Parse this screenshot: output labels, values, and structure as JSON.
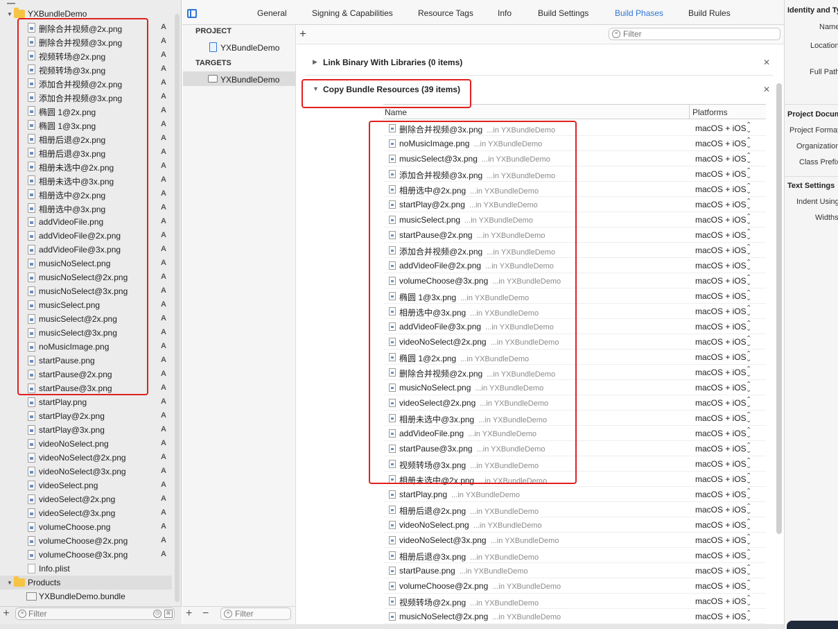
{
  "navigator": {
    "group_name": "YXBundleDemo",
    "files": [
      {
        "name": "删除合并视频@2x.png",
        "badge": "A"
      },
      {
        "name": "删除合并视频@3x.png",
        "badge": "A"
      },
      {
        "name": "视频转场@2x.png",
        "badge": "A"
      },
      {
        "name": "视频转场@3x.png",
        "badge": "A"
      },
      {
        "name": "添加合并视频@2x.png",
        "badge": "A"
      },
      {
        "name": "添加合并视频@3x.png",
        "badge": "A"
      },
      {
        "name": "椭圆 1@2x.png",
        "badge": "A"
      },
      {
        "name": "椭圆 1@3x.png",
        "badge": "A"
      },
      {
        "name": "相册后退@2x.png",
        "badge": "A"
      },
      {
        "name": "相册后退@3x.png",
        "badge": "A"
      },
      {
        "name": "相册未选中@2x.png",
        "badge": "A"
      },
      {
        "name": "相册未选中@3x.png",
        "badge": "A"
      },
      {
        "name": "相册选中@2x.png",
        "badge": "A"
      },
      {
        "name": "相册选中@3x.png",
        "badge": "A"
      },
      {
        "name": "addVideoFile.png",
        "badge": "A"
      },
      {
        "name": "addVideoFile@2x.png",
        "badge": "A"
      },
      {
        "name": "addVideoFile@3x.png",
        "badge": "A"
      },
      {
        "name": "musicNoSelect.png",
        "badge": "A"
      },
      {
        "name": "musicNoSelect@2x.png",
        "badge": "A"
      },
      {
        "name": "musicNoSelect@3x.png",
        "badge": "A"
      },
      {
        "name": "musicSelect.png",
        "badge": "A"
      },
      {
        "name": "musicSelect@2x.png",
        "badge": "A"
      },
      {
        "name": "musicSelect@3x.png",
        "badge": "A"
      },
      {
        "name": "noMusicImage.png",
        "badge": "A"
      },
      {
        "name": "startPause.png",
        "badge": "A"
      },
      {
        "name": "startPause@2x.png",
        "badge": "A"
      },
      {
        "name": "startPause@3x.png",
        "badge": "A"
      },
      {
        "name": "startPlay.png",
        "badge": "A"
      },
      {
        "name": "startPlay@2x.png",
        "badge": "A"
      },
      {
        "name": "startPlay@3x.png",
        "badge": "A"
      },
      {
        "name": "videoNoSelect.png",
        "badge": "A"
      },
      {
        "name": "videoNoSelect@2x.png",
        "badge": "A"
      },
      {
        "name": "videoNoSelect@3x.png",
        "badge": "A"
      },
      {
        "name": "videoSelect.png",
        "badge": "A"
      },
      {
        "name": "videoSelect@2x.png",
        "badge": "A"
      },
      {
        "name": "videoSelect@3x.png",
        "badge": "A"
      },
      {
        "name": "volumeChoose.png",
        "badge": "A"
      },
      {
        "name": "volumeChoose@2x.png",
        "badge": "A"
      },
      {
        "name": "volumeChoose@3x.png",
        "badge": "A"
      }
    ],
    "info_plist": "Info.plist",
    "products_group": "Products",
    "product_bundle": "YXBundleDemo.bundle",
    "filter_placeholder": "Filter"
  },
  "tabs": [
    "General",
    "Signing & Capabilities",
    "Resource Tags",
    "Info",
    "Build Settings",
    "Build Phases",
    "Build Rules"
  ],
  "selected_tab": "Build Phases",
  "project_list": {
    "project_header": "PROJECT",
    "project_name": "YXBundleDemo",
    "targets_header": "TARGETS",
    "target_name": "YXBundleDemo",
    "filter_placeholder": "Filter"
  },
  "build_phases": {
    "filter_placeholder": "Filter",
    "link_binary_title": "Link Binary With Libraries (0 items)",
    "copy_bundle_title": "Copy Bundle Resources (39 items)",
    "col_name": "Name",
    "col_platforms": "Platforms",
    "location_prefix": "...in",
    "location": "YXBundleDemo",
    "resources": [
      {
        "name": "删除合并视频@3x.png",
        "platforms": "macOS + iOS"
      },
      {
        "name": "noMusicImage.png",
        "platforms": "macOS + iOS"
      },
      {
        "name": "musicSelect@3x.png",
        "platforms": "macOS + iOS"
      },
      {
        "name": "添加合并视频@3x.png",
        "platforms": "macOS + iOS"
      },
      {
        "name": "相册选中@2x.png",
        "platforms": "macOS + iOS"
      },
      {
        "name": "startPlay@2x.png",
        "platforms": "macOS + iOS"
      },
      {
        "name": "musicSelect.png",
        "platforms": "macOS + iOS"
      },
      {
        "name": "startPause@2x.png",
        "platforms": "macOS + iOS"
      },
      {
        "name": "添加合并视频@2x.png",
        "platforms": "macOS + iOS"
      },
      {
        "name": "addVideoFile@2x.png",
        "platforms": "macOS + iOS"
      },
      {
        "name": "volumeChoose@3x.png",
        "platforms": "macOS + iOS"
      },
      {
        "name": "椭圆 1@3x.png",
        "platforms": "macOS + iOS"
      },
      {
        "name": "相册选中@3x.png",
        "platforms": "macOS + iOS"
      },
      {
        "name": "addVideoFile@3x.png",
        "platforms": "macOS + iOS"
      },
      {
        "name": "videoNoSelect@2x.png",
        "platforms": "macOS + iOS"
      },
      {
        "name": "椭圆 1@2x.png",
        "platforms": "macOS + iOS"
      },
      {
        "name": "删除合并视频@2x.png",
        "platforms": "macOS + iOS"
      },
      {
        "name": "musicNoSelect.png",
        "platforms": "macOS + iOS"
      },
      {
        "name": "videoSelect@2x.png",
        "platforms": "macOS + iOS"
      },
      {
        "name": "相册未选中@3x.png",
        "platforms": "macOS + iOS"
      },
      {
        "name": "addVideoFile.png",
        "platforms": "macOS + iOS"
      },
      {
        "name": "startPause@3x.png",
        "platforms": "macOS + iOS"
      },
      {
        "name": "视频转场@3x.png",
        "platforms": "macOS + iOS"
      },
      {
        "name": "相册未选中@2x.png",
        "platforms": "macOS + iOS"
      },
      {
        "name": "startPlay.png",
        "platforms": "macOS + iOS"
      },
      {
        "name": "相册后退@2x.png",
        "platforms": "macOS + iOS"
      },
      {
        "name": "videoNoSelect.png",
        "platforms": "macOS + iOS"
      },
      {
        "name": "videoNoSelect@3x.png",
        "platforms": "macOS + iOS"
      },
      {
        "name": "相册后退@3x.png",
        "platforms": "macOS + iOS"
      },
      {
        "name": "startPause.png",
        "platforms": "macOS + iOS"
      },
      {
        "name": "volumeChoose@2x.png",
        "platforms": "macOS + iOS"
      },
      {
        "name": "视频转场@2x.png",
        "platforms": "macOS + iOS"
      },
      {
        "name": "musicNoSelect@2x.png",
        "platforms": "macOS + iOS"
      }
    ]
  },
  "inspector": {
    "identity_header": "Identity and Ty",
    "name_label": "Name",
    "location_label": "Location",
    "full_path_label": "Full Path",
    "project_doc_header": "Project Docum",
    "project_format_label": "Project Format",
    "organization_label": "Organization",
    "class_prefix_label": "Class Prefix",
    "text_settings_header": "Text Settings",
    "indent_using_label": "Indent Using",
    "widths_label": "Widths"
  },
  "colors": {
    "accent": "#2f76d6",
    "highlight_red": "#e02020",
    "folder_yellow": "#f6c344"
  }
}
